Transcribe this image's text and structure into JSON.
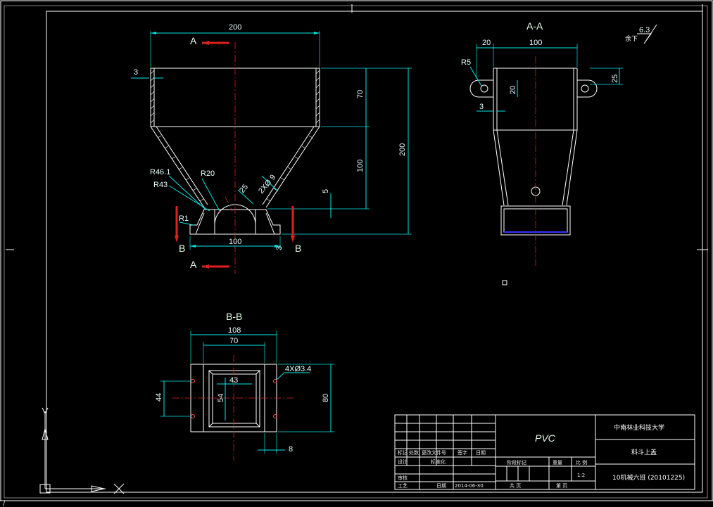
{
  "views": {
    "front": {
      "section_top": "A",
      "section_bottom": "A",
      "section_left": "B",
      "section_right": "B",
      "dims": {
        "top_width": "200",
        "wall": "3",
        "h70": "70",
        "h100": "100",
        "h200": "200",
        "r461": "R46.1",
        "r43": "R43",
        "r20": "R20",
        "r1": "R1",
        "d25": "25",
        "d20": "2XØ 9",
        "d5": "5",
        "base": "100",
        "d3": "3"
      }
    },
    "aa": {
      "title": "A-A",
      "dims": {
        "w20": "20",
        "w100": "100",
        "r5": "R5",
        "h20": "20",
        "h25": "25",
        "d3": "3"
      },
      "roughness": {
        "label": "余下",
        "value": "6.3"
      }
    },
    "bb": {
      "title": "B-B",
      "dims": {
        "w108": "108",
        "w70": "70",
        "w43": "43",
        "h54": "54",
        "h44": "44",
        "h80": "80",
        "holes": "4XØ3.4",
        "d8": "8"
      }
    }
  },
  "title_block": {
    "material": "PVC",
    "school": "中南林业科技大学",
    "part_name": "料斗上盖",
    "drawing_no": "10机械六班 (20101225)",
    "scale_label": "比 例",
    "scale_value": "1:2",
    "weight_label": "重量",
    "stage_label": "阶段标记",
    "sheet_label": "共 页",
    "page_label": "第 页",
    "date_label": "日期",
    "date_value": "2014-06-30",
    "left_cells": [
      "标记",
      "处数",
      "更改文件号",
      "签字",
      "日期"
    ],
    "role_cells": [
      "设计",
      "标准化",
      "审核",
      "工艺"
    ]
  }
}
